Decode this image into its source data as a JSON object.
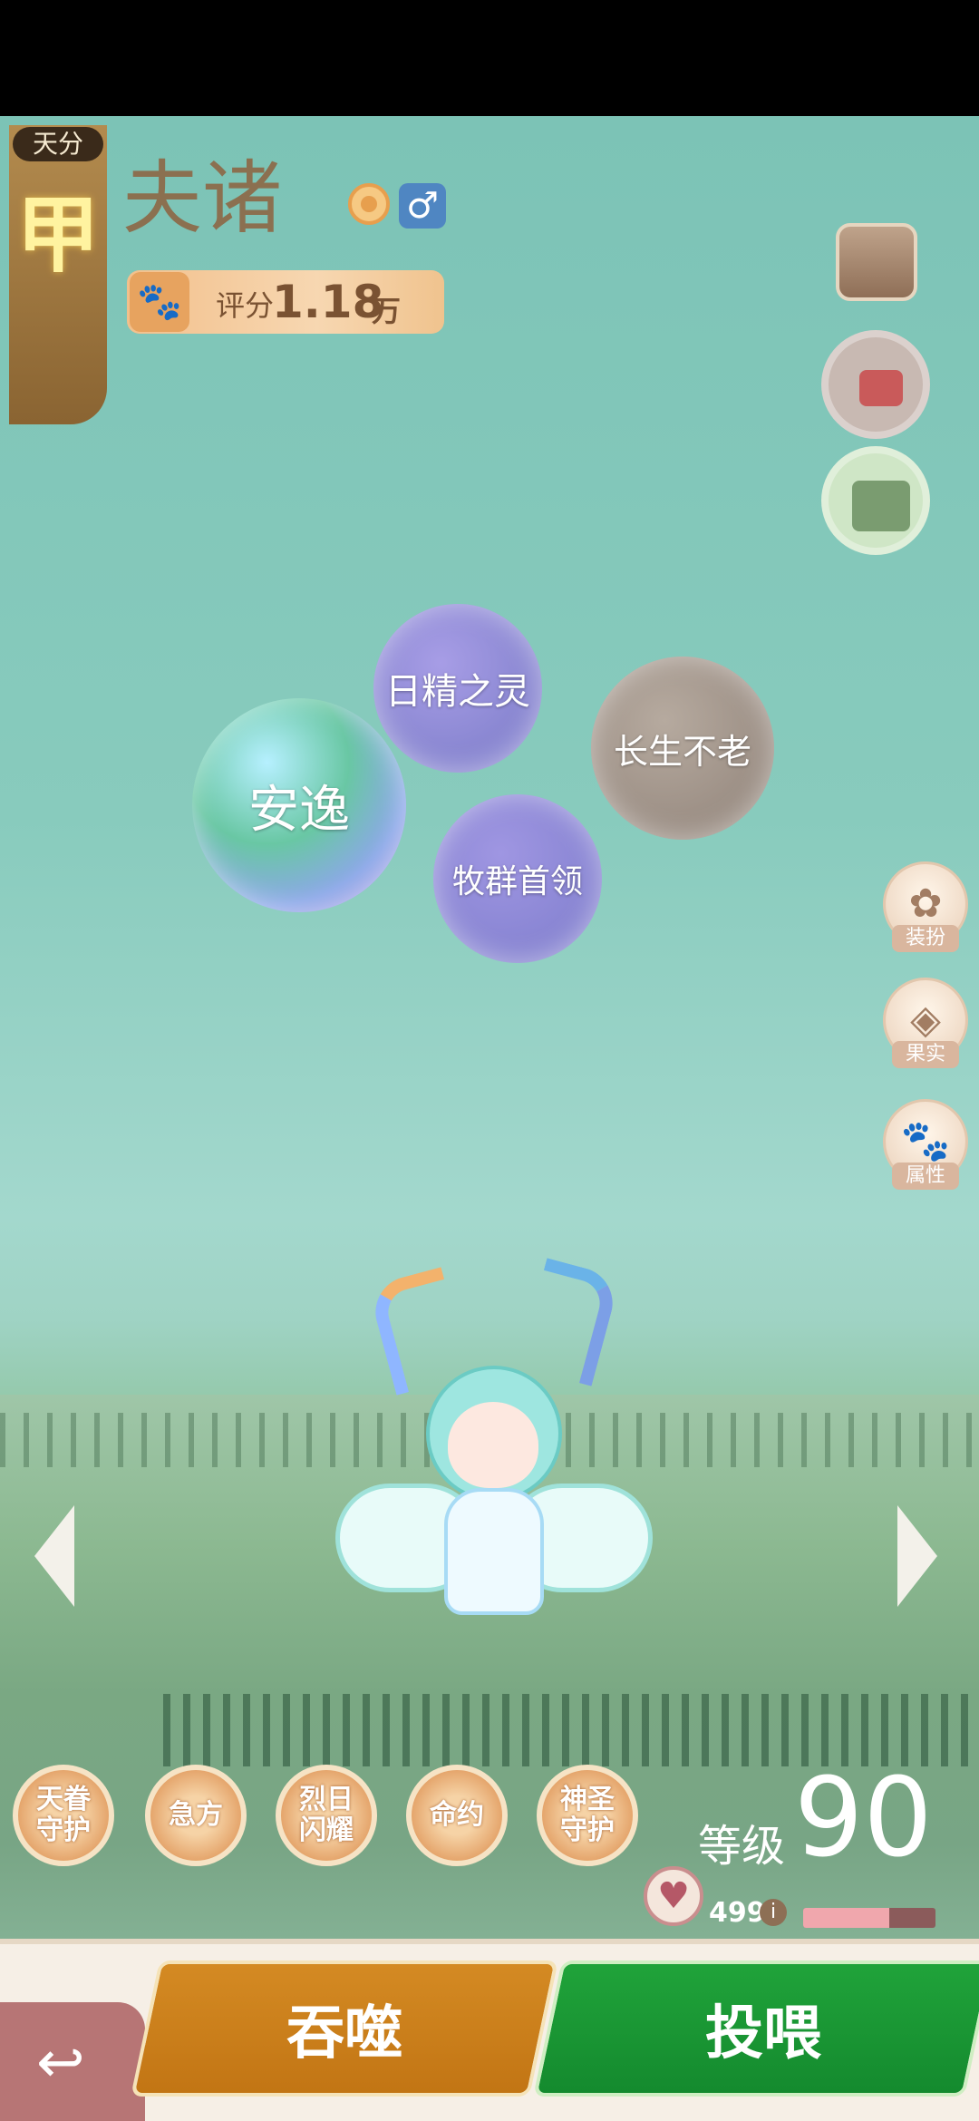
{
  "header": {
    "tier_label": "天分",
    "tier_value": "甲",
    "name": "夫诸",
    "gender_icon": "male-icon",
    "score_label": "评分",
    "score_value": "1.18",
    "score_unit": "万"
  },
  "traits": [
    "日精之灵",
    "安逸",
    "长生不老",
    "牧群首领"
  ],
  "side_buttons": [
    {
      "label": "装扮",
      "icon": "butterfly-icon"
    },
    {
      "label": "果实",
      "icon": "fruit-icon"
    },
    {
      "label": "属性",
      "icon": "paw-icon"
    }
  ],
  "skills": [
    "天眷守护",
    "急方",
    "烈日闪耀",
    "命约",
    "神圣守护"
  ],
  "level": {
    "label": "等级",
    "value": "90"
  },
  "affection": {
    "count": "499",
    "fill_fraction": 0.65
  },
  "actions": {
    "devour": "吞噬",
    "feed": "投喂"
  },
  "colors": {
    "devour": "#c27514",
    "feed": "#148a2e",
    "sky": "#7cc3b6"
  }
}
